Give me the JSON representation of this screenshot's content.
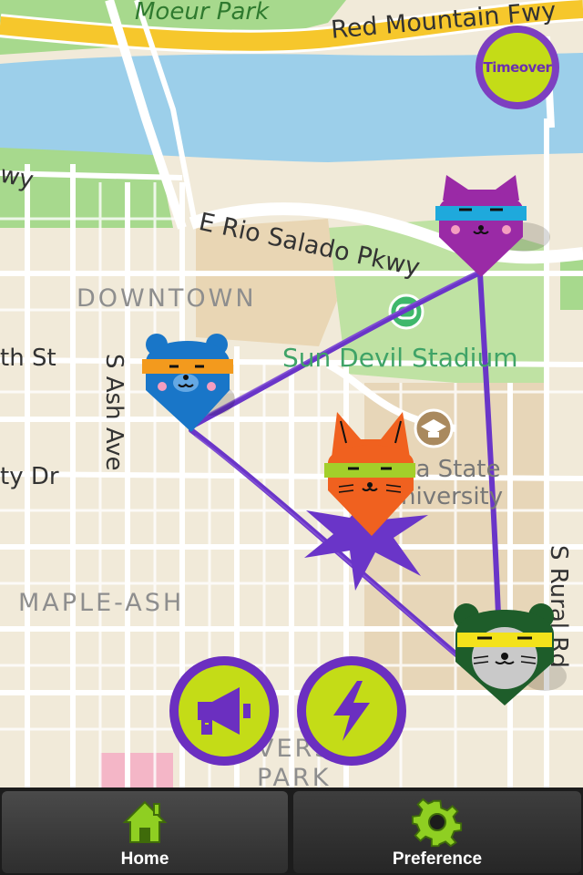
{
  "map": {
    "labels": {
      "moeur_park": "Moeur Park",
      "red_mountain_fwy": "Red Mountain Fwy",
      "wy_fragment": "wy",
      "e_rio_salado": "E Rio Salado Pkwy",
      "downtown": "DOWNTOWN",
      "sun_devil_stadium": "Sun Devil Stadium",
      "th_st": "th St",
      "s_ash_ave": "S Ash Ave",
      "ty_dr": "ty Dr",
      "asu": "na State\nniversity",
      "maple_ash": "MAPLE-ASH",
      "s_rural_rd": "S Rural Rd",
      "verity_park": "VERSITY\nPARK"
    },
    "colors": {
      "land": "#f1ead9",
      "water": "#9ccfea",
      "park": "#a7d98d",
      "freeway": "#f6c72c",
      "route_line": "#6a35c8"
    }
  },
  "players": [
    {
      "name": "bear-blue",
      "color": "#1976c8",
      "band": "#f39a1d"
    },
    {
      "name": "cat-purple",
      "color": "#9a2aa6",
      "band": "#1fa9dc"
    },
    {
      "name": "fox-orange",
      "color": "#f0611f",
      "band": "#a3cf2a"
    },
    {
      "name": "bear-green",
      "color": "#1e5d2a",
      "band": "#f3e21b"
    }
  ],
  "timeover": {
    "label": "Timeover"
  },
  "actions": {
    "megaphone": "megaphone-icon",
    "lightning": "lightning-icon"
  },
  "tabbar": {
    "tabs": [
      {
        "label": "Home",
        "icon": "home-icon"
      },
      {
        "label": "Preference",
        "icon": "gear-icon"
      }
    ]
  }
}
